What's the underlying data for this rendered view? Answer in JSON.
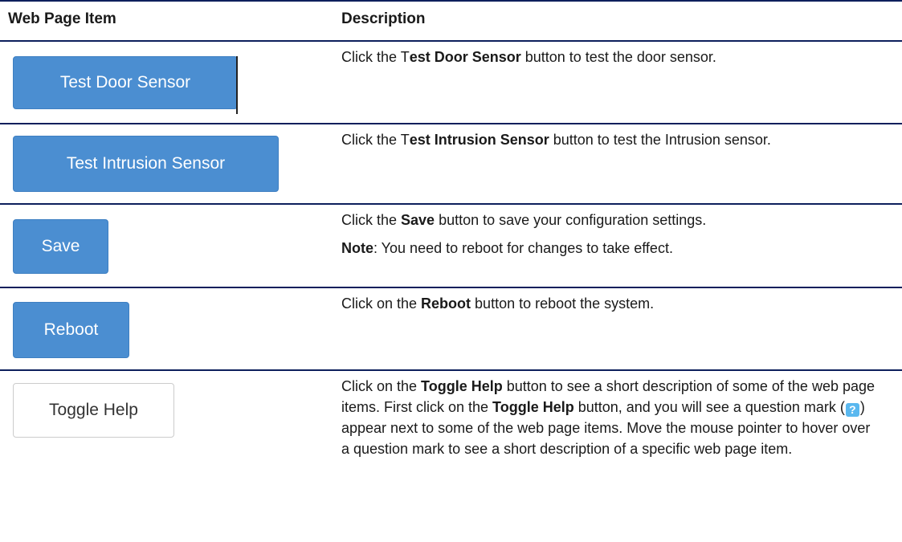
{
  "header": {
    "col_item": "Web Page Item",
    "col_description": "Description"
  },
  "rows": [
    {
      "button_label": "Test Door Sensor",
      "desc": {
        "pre": "Click the T",
        "bold": "est Door Sensor",
        "post": " button to test the door sensor."
      }
    },
    {
      "button_label": "Test Intrusion Sensor",
      "desc": {
        "pre": "Click the T",
        "bold": "est Intrusion Sensor",
        "post": " button to test the Intrusion sensor."
      }
    },
    {
      "button_label": "Save",
      "desc": {
        "pre": "Click the ",
        "bold": "Save",
        "post": " button to save your configuration settings."
      },
      "note": {
        "bold": "Note",
        "text": ": You need to reboot for changes to take effect."
      }
    },
    {
      "button_label": "Reboot",
      "desc": {
        "pre": "Click on the ",
        "bold": "Reboot",
        "post": " button to reboot the system."
      }
    },
    {
      "button_label": "Toggle Help",
      "desc": {
        "t1": "Click on the ",
        "b1": "Toggle Help",
        "t2": " button to see a short description of some of the web page items. First click on the ",
        "b2": "Toggle Help",
        "t3": " button, and you will see a question mark (",
        "icon": "?",
        "t4": ") appear next to some of the web page items. Move the mouse pointer to hover over a question mark to see a short description of a specific web page item."
      }
    }
  ],
  "colors": {
    "rule": "#0d1f5c",
    "primary_button": "#4b8ed1",
    "help_icon": "#5ab8ef"
  },
  "icons": [
    "help-question-icon"
  ]
}
